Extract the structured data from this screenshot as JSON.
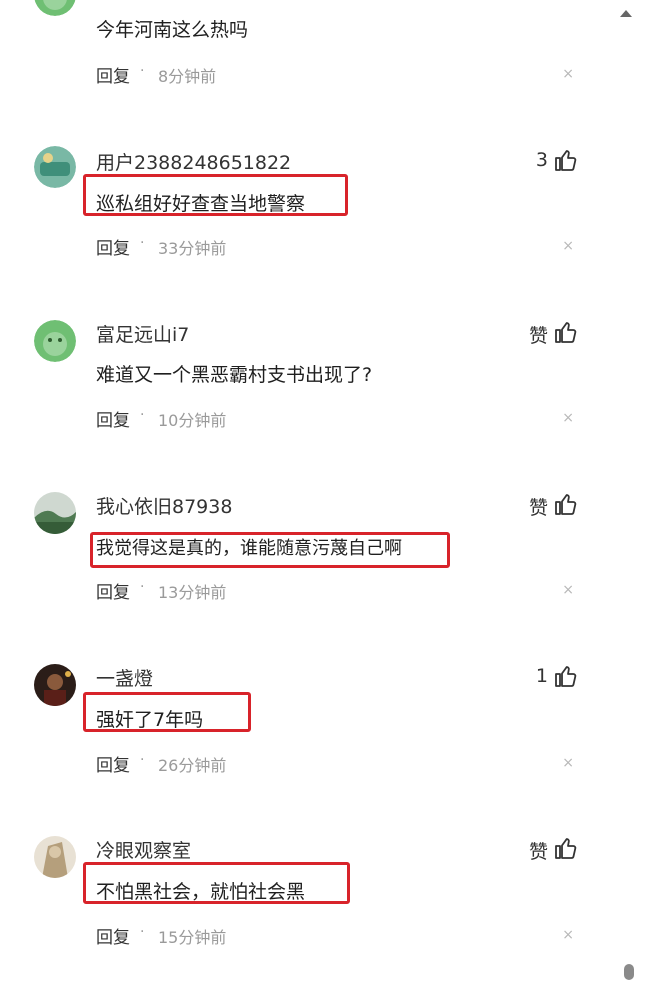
{
  "comments": [
    {
      "username": "",
      "text": "今年河南这么热吗",
      "reply": "回复",
      "time": "8分钟前",
      "like": "",
      "close": "×",
      "avatar_color": "#6fbf73"
    },
    {
      "username": "用户2388248651822",
      "text": "巡私组好好查查当地警察",
      "reply": "回复",
      "time": "33分钟前",
      "like": "3",
      "close": "×",
      "avatar_color": "#79b8a5"
    },
    {
      "username": "富足远山i7",
      "text": "难道又一个黑恶霸村支书出现了?",
      "reply": "回复",
      "time": "10分钟前",
      "like": "赞",
      "close": "×",
      "avatar_color": "#6fbf73"
    },
    {
      "username": "我心依旧87938",
      "text": "我觉得这是真的，谁能随意污蔑自己啊",
      "reply": "回复",
      "time": "13分钟前",
      "like": "赞",
      "close": "×",
      "avatar_color": "#5d8a5e"
    },
    {
      "username": "一盏燈",
      "text": "强奸了7年吗",
      "reply": "回复",
      "time": "26分钟前",
      "like": "1",
      "close": "×",
      "avatar_color": "#3b2a24"
    },
    {
      "username": "冷眼观察室",
      "text": "不怕黑社会，就怕社会黑",
      "reply": "回复",
      "time": "15分钟前",
      "like": "赞",
      "close": "×",
      "avatar_color": "#c9b79c"
    }
  ],
  "highlight_color": "#d8232a",
  "dot": "·"
}
